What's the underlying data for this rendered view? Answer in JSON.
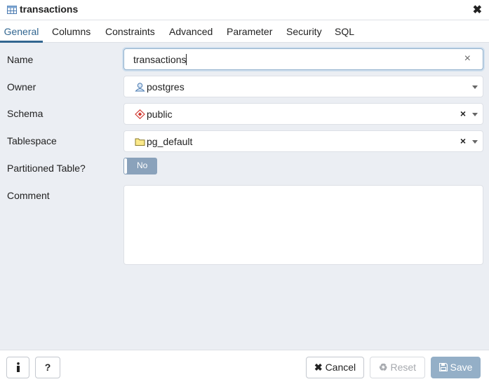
{
  "dialog": {
    "title": "transactions",
    "close_icon": "close-icon"
  },
  "tabs": [
    {
      "label": "General",
      "active": true
    },
    {
      "label": "Columns"
    },
    {
      "label": "Constraints"
    },
    {
      "label": "Advanced"
    },
    {
      "label": "Parameter"
    },
    {
      "label": "Security"
    },
    {
      "label": "SQL"
    }
  ],
  "form": {
    "name": {
      "label": "Name",
      "value": "transactions"
    },
    "owner": {
      "label": "Owner",
      "value": "postgres",
      "icon": "user-icon"
    },
    "schema": {
      "label": "Schema",
      "value": "public",
      "icon": "schema-icon"
    },
    "tablespace": {
      "label": "Tablespace",
      "value": "pg_default",
      "icon": "folder-icon"
    },
    "partitioned": {
      "label": "Partitioned Table?",
      "value": "No"
    },
    "comment": {
      "label": "Comment",
      "value": ""
    }
  },
  "footer": {
    "info_icon": "info-icon",
    "help_icon": "help-icon",
    "cancel": "Cancel",
    "reset": "Reset",
    "save": "Save"
  },
  "colors": {
    "accent": "#326690",
    "toggle_bg": "#8aa2bb",
    "save_bg": "#94afc7",
    "page_bg": "#ebeef3"
  }
}
